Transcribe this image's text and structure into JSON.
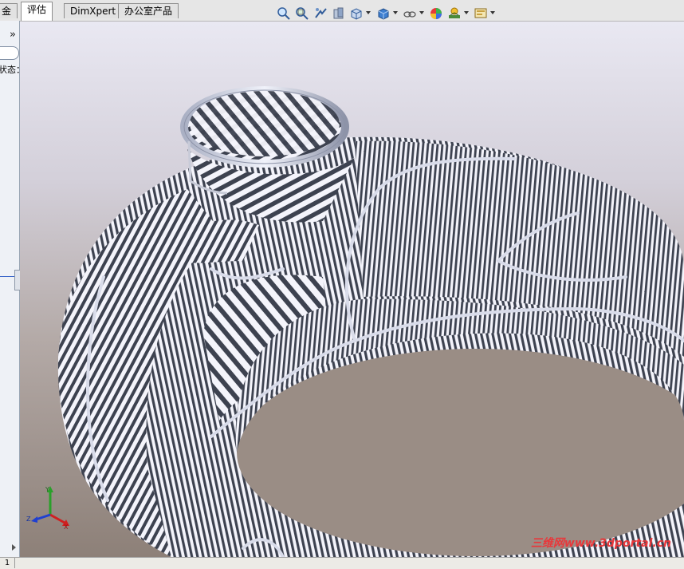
{
  "tabs": [
    {
      "label": "金",
      "active": false
    },
    {
      "label": "评估",
      "active": true
    },
    {
      "label": "DimXpert",
      "active": false
    },
    {
      "label": "办公室产品",
      "active": false
    }
  ],
  "toolbar_icons": [
    "zoom-to-fit-icon",
    "zoom-to-area-icon",
    "previous-view-icon",
    "section-view-icon",
    "view-orientation-icon",
    "display-style-icon",
    "hide-show-items-icon",
    "edit-appearance-icon",
    "apply-scene-icon",
    "view-settings-icon"
  ],
  "left_panel": {
    "expand_label": "»",
    "state_label": "状态："
  },
  "triad": {
    "x_label": "X",
    "y_label": "Y",
    "z_label": "Z"
  },
  "status_bar": {
    "page_label": "1"
  },
  "watermark": "三维网www.3dportal.cn",
  "colors": {
    "stripe_dark": "#3d4250",
    "stripe_light": "#f4f4fb",
    "tab_border": "#8e8e8e"
  }
}
